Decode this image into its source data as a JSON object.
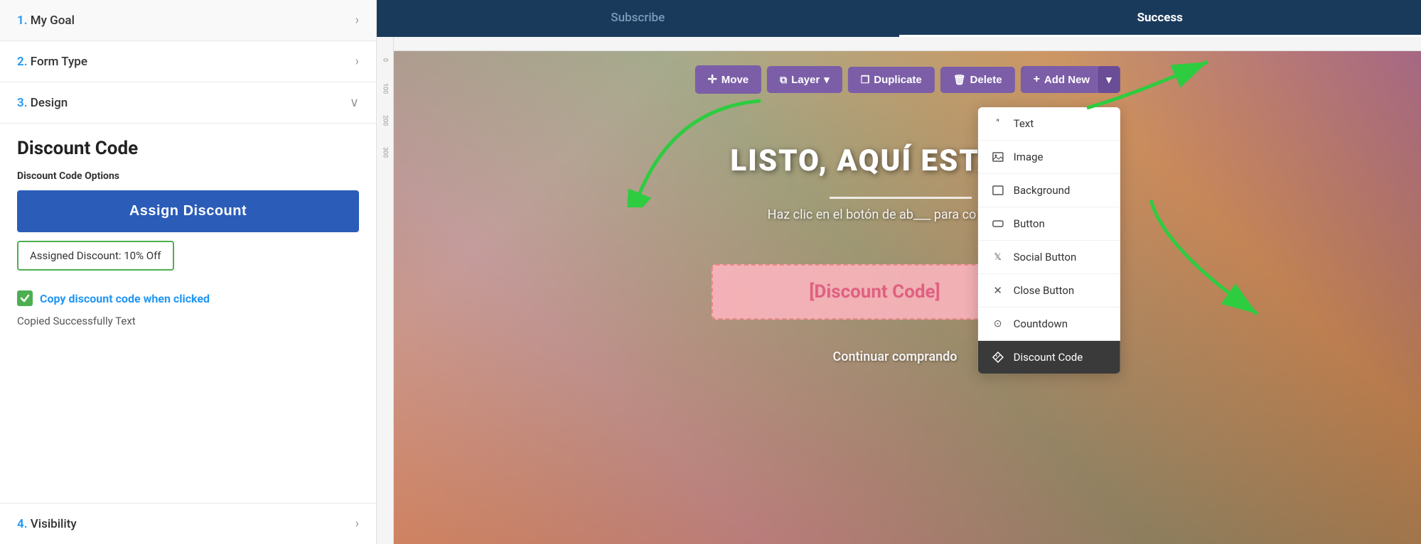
{
  "sidebar": {
    "nav_items": [
      {
        "id": "my-goal",
        "number": "1.",
        "label": "My Goal"
      },
      {
        "id": "form-type",
        "number": "2.",
        "label": "Form Type"
      }
    ],
    "design": {
      "number": "3.",
      "label": "Design"
    },
    "discount_code": {
      "title": "Discount Code",
      "options_label": "Discount Code Options",
      "assign_btn": "Assign Discount",
      "assigned_text": "Assigned Discount: 10% Off",
      "copy_label": "Copy discount code when clicked",
      "copied_text_label": "Copied Successfully Text"
    },
    "visibility": {
      "number": "4.",
      "label": "Visibility"
    }
  },
  "tabs": [
    {
      "id": "subscribe",
      "label": "Subscribe",
      "active": false
    },
    {
      "id": "success",
      "label": "Success",
      "active": true
    }
  ],
  "toolbar": {
    "move": "Move",
    "layer": "Layer",
    "duplicate": "Duplicate",
    "delete": "Delete",
    "add_new": "Add New"
  },
  "dropdown": {
    "items": [
      {
        "id": "text",
        "label": "Text",
        "icon": "text"
      },
      {
        "id": "image",
        "label": "Image",
        "icon": "image"
      },
      {
        "id": "background",
        "label": "Background",
        "icon": "background"
      },
      {
        "id": "button",
        "label": "Button",
        "icon": "button"
      },
      {
        "id": "social-button",
        "label": "Social Button",
        "icon": "social"
      },
      {
        "id": "close-button",
        "label": "Close Button",
        "icon": "close"
      },
      {
        "id": "countdown",
        "label": "Countdown",
        "icon": "countdown"
      },
      {
        "id": "discount-code",
        "label": "Discount Code",
        "icon": "discount",
        "active": true
      }
    ]
  },
  "canvas": {
    "main_text": "LISTO, AQUÍ ESTÁ TU",
    "sub_text": "Haz clic en el botón de ab___ para co",
    "discount_placeholder": "[Discount Code]",
    "continue_text": "Continuar comprando"
  },
  "arrows": {
    "arrow1_label": "points to assign discount",
    "arrow2_label": "points to success tab",
    "arrow3_label": "points to discount code menu item"
  }
}
